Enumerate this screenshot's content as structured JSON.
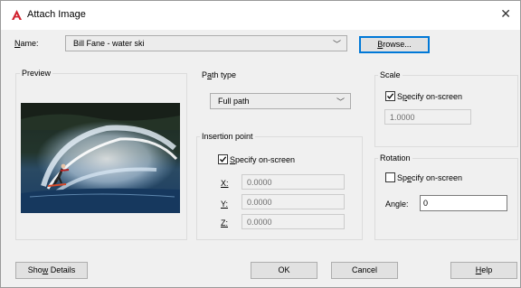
{
  "dialog": {
    "title": "Attach Image",
    "close_glyph": "✕"
  },
  "name_row": {
    "label": "Name:",
    "label_underline_char": "N",
    "label_rest": "ame:",
    "value": "Bill Fane - water ski",
    "browse_label_first": "B",
    "browse_label_rest": "rowse..."
  },
  "preview": {
    "title": "Preview"
  },
  "path_type": {
    "title_first": "P",
    "title_underline": "a",
    "title_rest": "th type",
    "value": "Full path"
  },
  "insertion": {
    "title": "Insertion point",
    "specify_first": "",
    "specify_underline": "S",
    "specify_rest": "pecify on-screen",
    "specify_checked": true,
    "x_label": "X:",
    "x_value": "0.0000",
    "y_label": "Y:",
    "y_value": "0.0000",
    "z_label": "Z:",
    "z_value": "0.0000"
  },
  "scale": {
    "title": "Scale",
    "specify_first": "S",
    "specify_underline": "p",
    "specify_rest": "ecify on-screen",
    "specify_checked": true,
    "value": "1.0000"
  },
  "rotation": {
    "title": "Rotation",
    "specify_first": "Sp",
    "specify_underline": "e",
    "specify_rest": "cify on-screen",
    "specify_checked": false,
    "angle_label_first": "An",
    "angle_label_underline": "g",
    "angle_label_rest": "le:",
    "angle_value": "0"
  },
  "buttons": {
    "details_first": "Sho",
    "details_underline": "w",
    "details_rest": " Details",
    "ok": "OK",
    "cancel": "Cancel",
    "help_first": "",
    "help_underline": "H",
    "help_rest": "elp"
  },
  "colors": {
    "accent": "#0078d7",
    "app_icon": "#d1212e"
  }
}
